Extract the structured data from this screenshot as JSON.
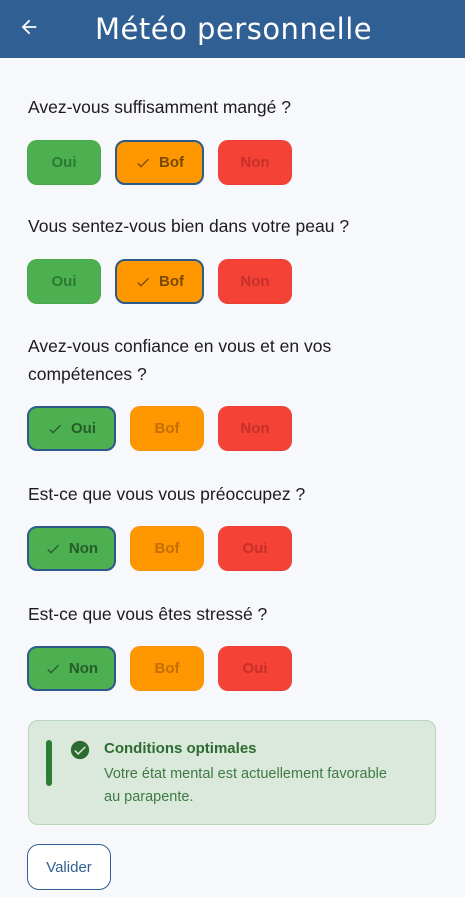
{
  "header": {
    "title": "Météo personnelle"
  },
  "questions": [
    {
      "label": "Avez-vous suffisamment mangé ?",
      "options": [
        "Oui",
        "Bof",
        "Non"
      ],
      "selected": "Bof"
    },
    {
      "label": "Vous sentez-vous bien dans votre peau ?",
      "options": [
        "Oui",
        "Bof",
        "Non"
      ],
      "selected": "Bof"
    },
    {
      "label": "Avez-vous confiance en vous et en vos compétences ?",
      "options": [
        "Oui",
        "Bof",
        "Non"
      ],
      "selected": "Oui"
    },
    {
      "label": "Est-ce que vous vous préoccupez ?",
      "options": [
        "Non",
        "Bof",
        "Oui"
      ],
      "selected": "Non"
    },
    {
      "label": "Est-ce que vous êtes stressé ?",
      "options": [
        "Non",
        "Bof",
        "Oui"
      ],
      "selected": "Non"
    }
  ],
  "result": {
    "title": "Conditions optimales",
    "description": "Votre état mental est actuellement favorable au parapente."
  },
  "actions": {
    "validate_label": "Valider"
  },
  "colors": {
    "good": "#4caf50",
    "medium": "#ff9800",
    "bad": "#f44336",
    "brand": "#2f5f93"
  }
}
